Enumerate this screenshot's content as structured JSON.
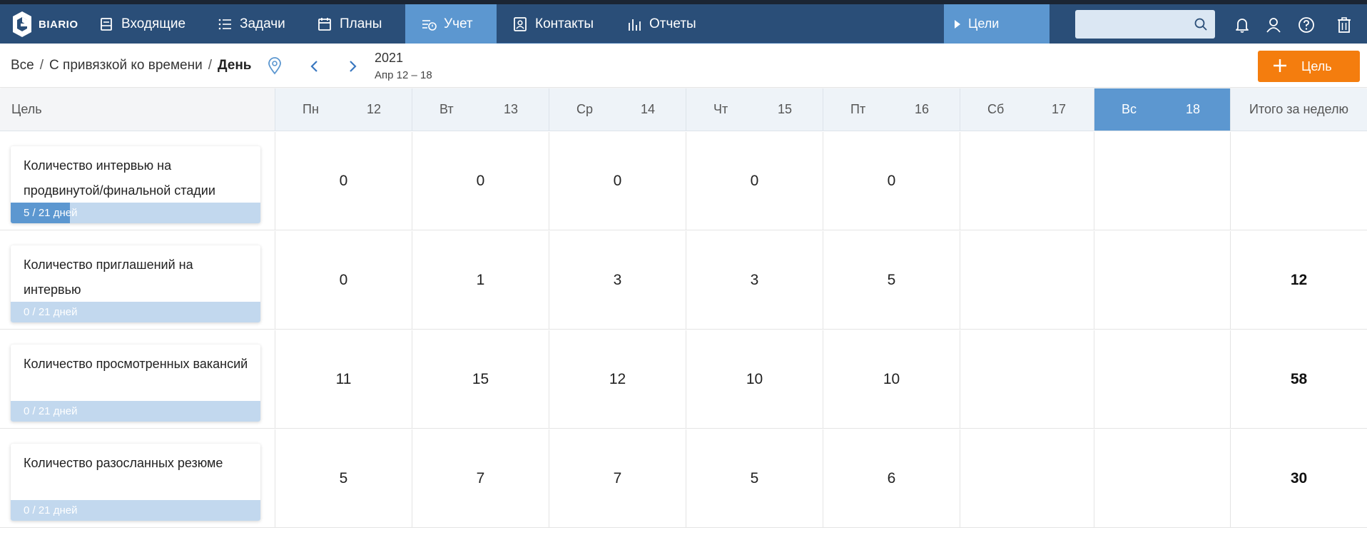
{
  "app": {
    "brand": "BIARIO"
  },
  "nav": {
    "items": [
      {
        "label": "Входящие",
        "icon": "inbox-icon"
      },
      {
        "label": "Задачи",
        "icon": "list-icon"
      },
      {
        "label": "Планы",
        "icon": "calendar-icon"
      },
      {
        "label": "Учет",
        "icon": "tracking-icon",
        "active": true
      },
      {
        "label": "Контакты",
        "icon": "contacts-icon"
      },
      {
        "label": "Отчеты",
        "icon": "reports-icon"
      }
    ],
    "goals_tab": "Цели"
  },
  "search": {
    "placeholder": "",
    "value": ""
  },
  "toolbar": {
    "breadcrumb": [
      "Все",
      "С привязкой ко времени",
      "День"
    ],
    "separator": "/",
    "year": "2021",
    "range": "Апр 12 – 18",
    "add_goal": "Цель"
  },
  "table": {
    "goal_header": "Цель",
    "total_header": "Итого за неделю",
    "days": [
      {
        "name": "Пн",
        "date": "12",
        "today": false
      },
      {
        "name": "Вт",
        "date": "13",
        "today": false
      },
      {
        "name": "Ср",
        "date": "14",
        "today": false
      },
      {
        "name": "Чт",
        "date": "15",
        "today": false
      },
      {
        "name": "Пт",
        "date": "16",
        "today": false
      },
      {
        "name": "Сб",
        "date": "17",
        "today": false
      },
      {
        "name": "Вс",
        "date": "18",
        "today": true
      }
    ],
    "rows": [
      {
        "goal": "Количество интервью на продвинутой/финальной стадии",
        "progress_text": "5 / 21 дней",
        "progress": 0.238,
        "values": [
          "0",
          "0",
          "0",
          "0",
          "0",
          "",
          ""
        ],
        "total": ""
      },
      {
        "goal": "Количество приглашений на интервью",
        "progress_text": "0 / 21 дней",
        "progress": 0,
        "values": [
          "0",
          "1",
          "3",
          "3",
          "5",
          "",
          ""
        ],
        "total": "12"
      },
      {
        "goal": "Количество просмотренных вакансий",
        "progress_text": "0 / 21 дней",
        "progress": 0,
        "values": [
          "11",
          "15",
          "12",
          "10",
          "10",
          "",
          ""
        ],
        "total": "58"
      },
      {
        "goal": "Количество разосланных резюме",
        "progress_text": "0 / 21 дней",
        "progress": 0,
        "values": [
          "5",
          "7",
          "7",
          "5",
          "6",
          "",
          ""
        ],
        "total": "30"
      }
    ]
  },
  "colors": {
    "nav_bg": "#2a4e78",
    "accent": "#5c97d0",
    "action": "#f47d0e",
    "progress_track": "#c2d8ee"
  }
}
